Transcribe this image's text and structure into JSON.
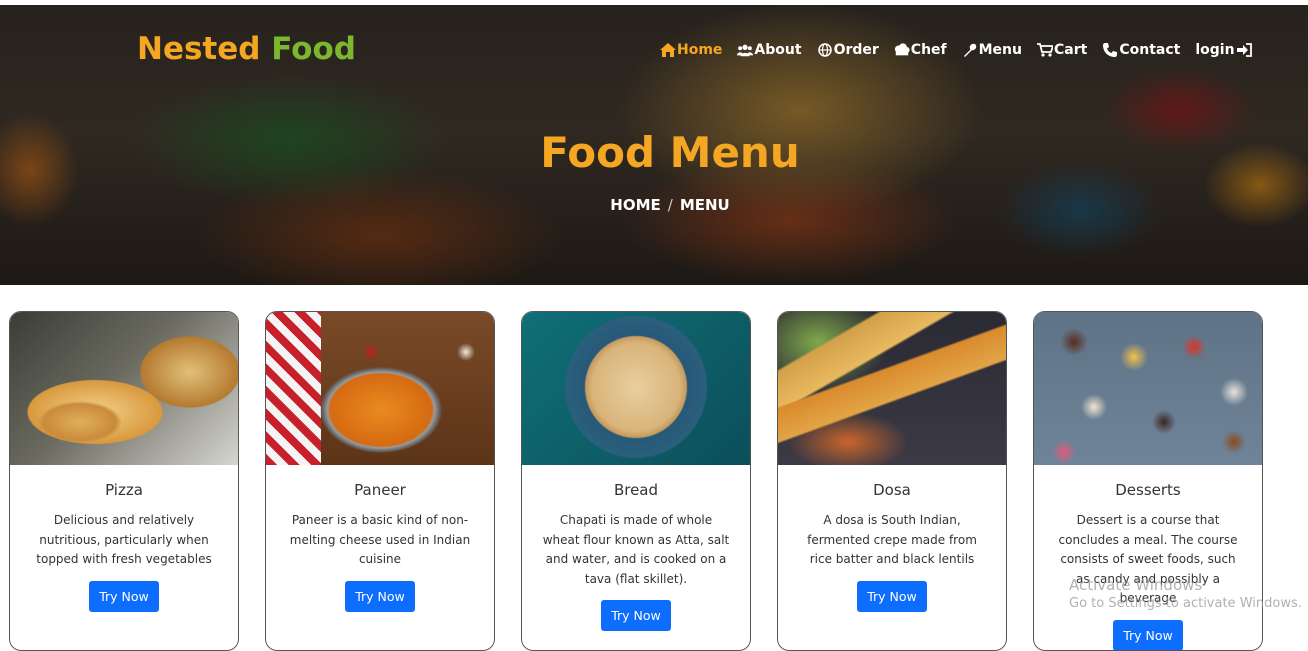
{
  "brand": {
    "word1": "Nested",
    "word2": "Food",
    "color1": "#f5a623",
    "color2": "#7cb82f"
  },
  "nav": {
    "items": [
      {
        "label": "Home",
        "icon": "home-icon",
        "active": true
      },
      {
        "label": "About",
        "icon": "users-icon",
        "active": false
      },
      {
        "label": "Order",
        "icon": "globe-icon",
        "active": false
      },
      {
        "label": "Chef",
        "icon": "chef-hat-icon",
        "active": false
      },
      {
        "label": "Menu",
        "icon": "spoon-icon",
        "active": false
      },
      {
        "label": "Cart",
        "icon": "cart-icon",
        "active": false
      },
      {
        "label": "Contact",
        "icon": "phone-icon",
        "active": false
      },
      {
        "label": "login",
        "icon": "login-icon",
        "active": false
      }
    ]
  },
  "hero": {
    "title": "Food Menu",
    "breadcrumb": {
      "home": "HOME",
      "separator": "/",
      "current": "MENU"
    }
  },
  "cards": [
    {
      "title": "Pizza",
      "description": "Delicious and relatively nutritious, particularly when topped with fresh vegetables",
      "button": "Try Now",
      "image": "pizza-image"
    },
    {
      "title": "Paneer",
      "description": "Paneer is a basic kind of non-melting cheese used in Indian cuisine",
      "button": "Try Now",
      "image": "paneer-image"
    },
    {
      "title": "Bread",
      "description": "Chapati is made of whole wheat flour known as Atta, salt and water, and is cooked on a tava (flat skillet).",
      "button": "Try Now",
      "image": "chapati-image"
    },
    {
      "title": "Dosa",
      "description": "A dosa is South Indian, fermented crepe made from rice batter and black lentils",
      "button": "Try Now",
      "image": "dosa-image"
    },
    {
      "title": "Desserts",
      "description": "Dessert is a course that concludes a meal. The course consists of sweet foods, such as candy and possibly a beverage",
      "button": "Try Now",
      "image": "desserts-image"
    }
  ],
  "watermark": {
    "line1": "Activate Windows",
    "line2": "Go to Settings to activate Windows."
  },
  "colors": {
    "accent": "#f5a623",
    "button": "#0d6efd"
  }
}
